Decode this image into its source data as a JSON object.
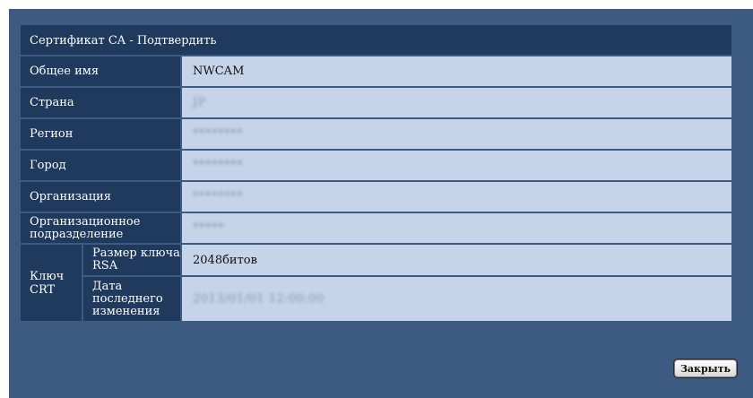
{
  "dialog": {
    "title": "Сертификат CA - Подтвердить",
    "close_label": "Закрыть"
  },
  "fields": [
    {
      "label": "Общее имя",
      "value": "NWCAM"
    },
    {
      "label": "Страна",
      "value": "JP"
    },
    {
      "label": "Регион",
      "value": "********"
    },
    {
      "label": "Город",
      "value": "********"
    },
    {
      "label": "Организация",
      "value": "********"
    },
    {
      "label": "Организационное подразделение",
      "value": "*****"
    }
  ],
  "crt": {
    "label": "Ключ CRT",
    "key_size_label": "Размер ключа RSA",
    "key_size_value": "2048битов",
    "modified_label": "Дата последнего изменения",
    "modified_value": "2013/01/01 12:00:00"
  }
}
